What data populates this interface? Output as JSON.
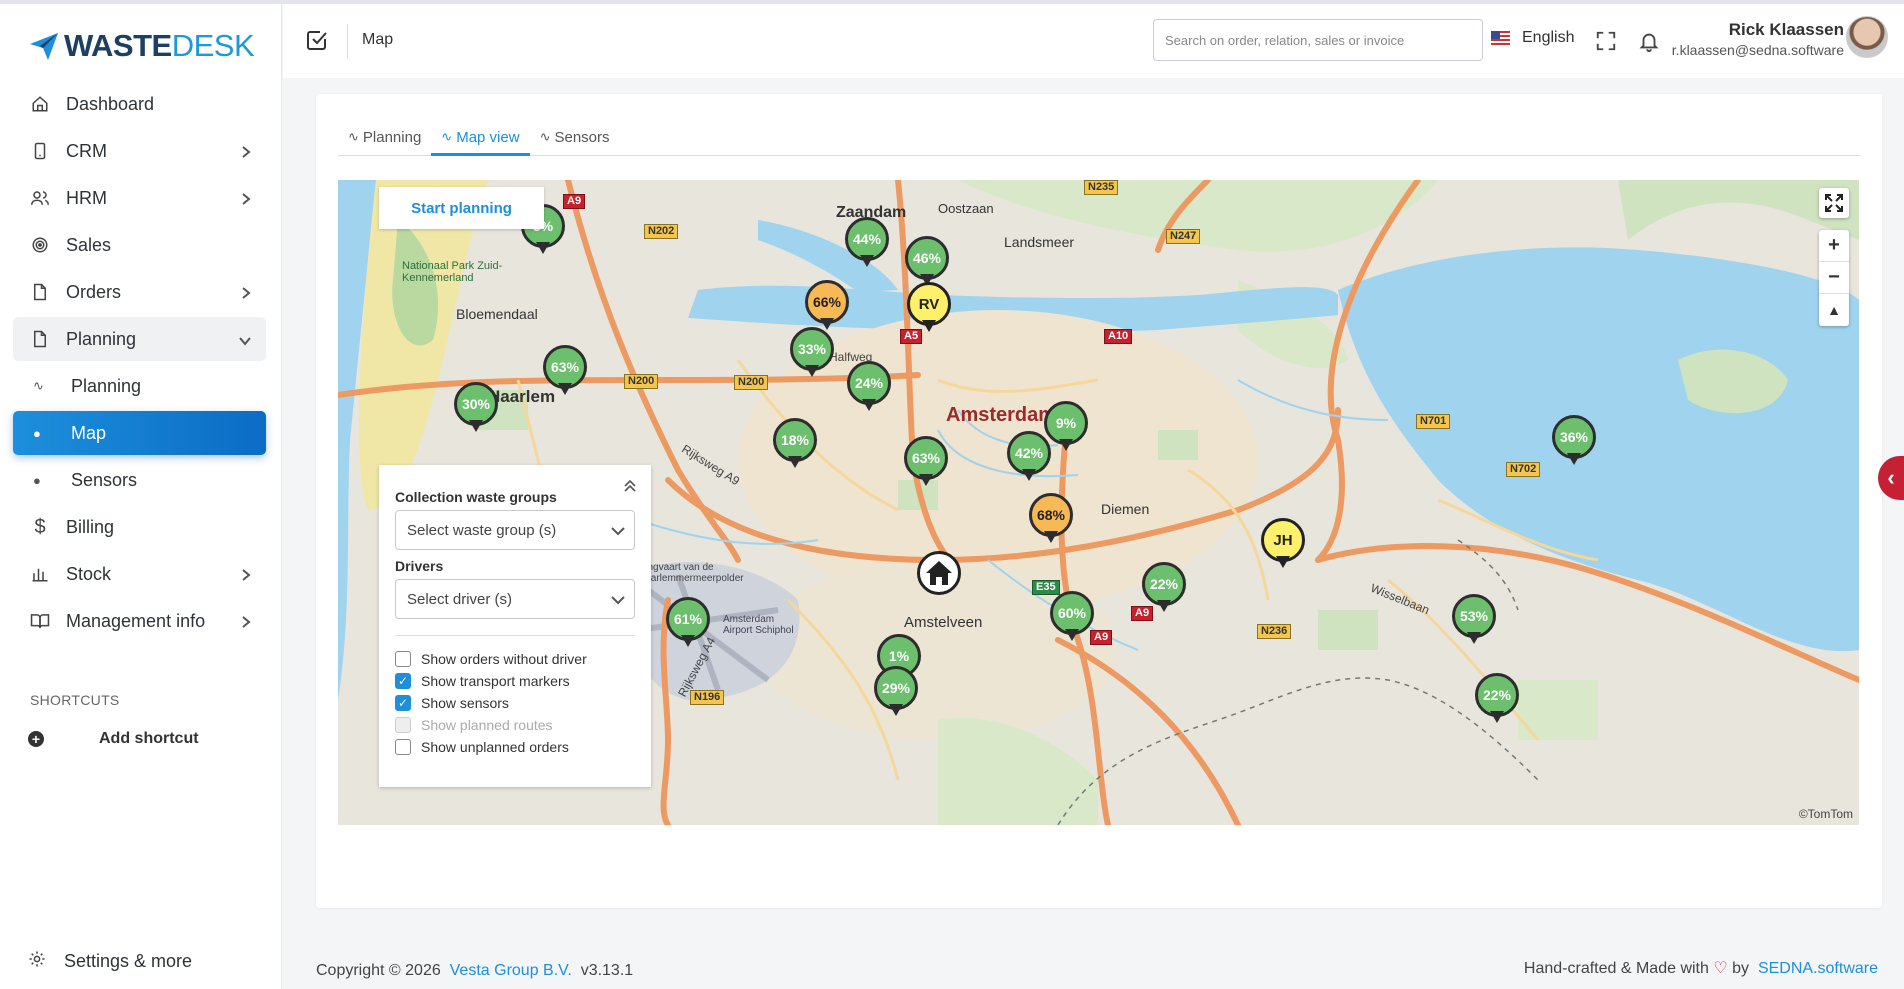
{
  "brand": {
    "name_bold": "WASTE",
    "name_light": "DESK"
  },
  "header": {
    "title": "Map",
    "search_placeholder": "Search on order, relation, sales or invoice",
    "language": "English",
    "user_name": "Rick Klaassen",
    "user_email": "r.klaassen@sedna.software"
  },
  "sidebar": {
    "items": [
      {
        "label": "Dashboard",
        "icon": "home-icon"
      },
      {
        "label": "CRM",
        "icon": "phone-icon"
      },
      {
        "label": "HRM",
        "icon": "users-icon"
      },
      {
        "label": "Sales",
        "icon": "target-icon"
      },
      {
        "label": "Orders",
        "icon": "file-icon"
      },
      {
        "label": "Planning",
        "icon": "file-icon"
      },
      {
        "label": "Billing",
        "icon": "dollar-icon"
      },
      {
        "label": "Stock",
        "icon": "chart-icon"
      },
      {
        "label": "Management info",
        "icon": "book-icon"
      }
    ],
    "planning_sub": [
      {
        "label": "Planning"
      },
      {
        "label": "Map"
      },
      {
        "label": "Sensors"
      }
    ],
    "shortcuts_title": "SHORTCUTS",
    "add_shortcut": "Add shortcut",
    "settings": "Settings & more"
  },
  "tabs": [
    {
      "label": "Planning"
    },
    {
      "label": "Map view"
    },
    {
      "label": "Sensors"
    }
  ],
  "map": {
    "start_planning": "Start planning",
    "attribution": "©TomTom",
    "city": "Amsterdam",
    "towns": [
      "Zaandam",
      "Oostzaan",
      "Landsmeer",
      "Bloemendaal",
      "Haarlem",
      "Diemen",
      "Amstelveen",
      "Nationaal Park Zuid-Kennemerland",
      "Amsterdam Airport Schiphol",
      "Halfweg",
      "Wisselbaan",
      "Rijksweg A9",
      "Rijksweg A4",
      "Ringvaart van de Haarlemmermeerpolder"
    ],
    "roads": [
      "A9",
      "N202",
      "N200",
      "N200",
      "A5",
      "A10",
      "N247",
      "N235",
      "N701",
      "N702",
      "E35",
      "A9",
      "N236",
      "N196",
      "A9"
    ],
    "markers": [
      {
        "label": "5%",
        "status": "green"
      },
      {
        "label": "44%",
        "status": "green"
      },
      {
        "label": "46%",
        "status": "green"
      },
      {
        "label": "66%",
        "status": "orange"
      },
      {
        "label": "33%",
        "status": "green"
      },
      {
        "label": "63%",
        "status": "green"
      },
      {
        "label": "30%",
        "status": "green"
      },
      {
        "label": "24%",
        "status": "green"
      },
      {
        "label": "18%",
        "status": "green"
      },
      {
        "label": "63%",
        "status": "green"
      },
      {
        "label": "42%",
        "status": "green"
      },
      {
        "label": "9%",
        "status": "green"
      },
      {
        "label": "68%",
        "status": "orange"
      },
      {
        "label": "22%",
        "status": "green"
      },
      {
        "label": "60%",
        "status": "green"
      },
      {
        "label": "61%",
        "status": "green"
      },
      {
        "label": "1%",
        "status": "green"
      },
      {
        "label": "29%",
        "status": "green"
      },
      {
        "label": "53%",
        "status": "green"
      },
      {
        "label": "36%",
        "status": "green"
      },
      {
        "label": "22%",
        "status": "green"
      }
    ],
    "drivers": [
      {
        "label": "RV"
      },
      {
        "label": "JH"
      }
    ]
  },
  "filters": {
    "waste_label": "Collection waste groups",
    "waste_placeholder": "Select waste group (s)",
    "drivers_label": "Drivers",
    "drivers_placeholder": "Select driver (s)",
    "checks": [
      {
        "label": "Show orders without driver",
        "checked": false
      },
      {
        "label": "Show transport markers",
        "checked": true
      },
      {
        "label": "Show sensors",
        "checked": true
      },
      {
        "label": "Show planned routes",
        "checked": false
      },
      {
        "label": "Show unplanned orders",
        "checked": false
      }
    ]
  },
  "footer": {
    "copyright": "Copyright © 2026",
    "company": "Vesta Group B.V.",
    "version": "v3.13.1",
    "crafted": "Hand-crafted & Made with",
    "by": "by",
    "sedna": "SEDNA.software"
  },
  "colors": {
    "accent": "#1d8fdc",
    "marker_green": "#6cbf6c",
    "marker_orange": "#f7b955",
    "driver_yellow": "#fdf16c"
  }
}
